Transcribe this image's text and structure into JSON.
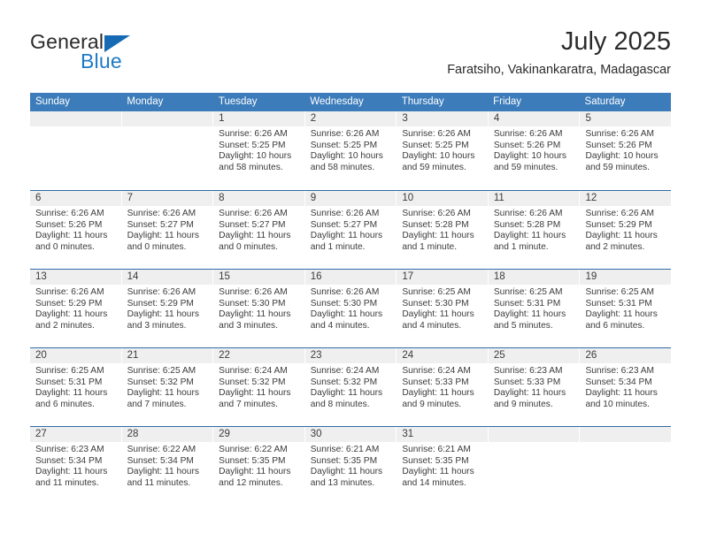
{
  "brand": {
    "name_part1": "General",
    "name_part2": "Blue",
    "triangle_color": "#166ab4",
    "blue_color": "#1f7ac4"
  },
  "header": {
    "title": "July 2025",
    "subtitle": "Faratsiho, Vakinankaratra, Madagascar"
  },
  "theme": {
    "header_row_bg": "#3c7cba",
    "row_divider": "#2f6ca8",
    "daynum_band": "#efefef",
    "text": "#3b3b3b"
  },
  "weekdays": [
    "Sunday",
    "Monday",
    "Tuesday",
    "Wednesday",
    "Thursday",
    "Friday",
    "Saturday"
  ],
  "weeks": [
    [
      {
        "day": ""
      },
      {
        "day": ""
      },
      {
        "day": "1",
        "sunrise": "Sunrise: 6:26 AM",
        "sunset": "Sunset: 5:25 PM",
        "daylight1": "Daylight: 10 hours",
        "daylight2": "and 58 minutes."
      },
      {
        "day": "2",
        "sunrise": "Sunrise: 6:26 AM",
        "sunset": "Sunset: 5:25 PM",
        "daylight1": "Daylight: 10 hours",
        "daylight2": "and 58 minutes."
      },
      {
        "day": "3",
        "sunrise": "Sunrise: 6:26 AM",
        "sunset": "Sunset: 5:25 PM",
        "daylight1": "Daylight: 10 hours",
        "daylight2": "and 59 minutes."
      },
      {
        "day": "4",
        "sunrise": "Sunrise: 6:26 AM",
        "sunset": "Sunset: 5:26 PM",
        "daylight1": "Daylight: 10 hours",
        "daylight2": "and 59 minutes."
      },
      {
        "day": "5",
        "sunrise": "Sunrise: 6:26 AM",
        "sunset": "Sunset: 5:26 PM",
        "daylight1": "Daylight: 10 hours",
        "daylight2": "and 59 minutes."
      }
    ],
    [
      {
        "day": "6",
        "sunrise": "Sunrise: 6:26 AM",
        "sunset": "Sunset: 5:26 PM",
        "daylight1": "Daylight: 11 hours",
        "daylight2": "and 0 minutes."
      },
      {
        "day": "7",
        "sunrise": "Sunrise: 6:26 AM",
        "sunset": "Sunset: 5:27 PM",
        "daylight1": "Daylight: 11 hours",
        "daylight2": "and 0 minutes."
      },
      {
        "day": "8",
        "sunrise": "Sunrise: 6:26 AM",
        "sunset": "Sunset: 5:27 PM",
        "daylight1": "Daylight: 11 hours",
        "daylight2": "and 0 minutes."
      },
      {
        "day": "9",
        "sunrise": "Sunrise: 6:26 AM",
        "sunset": "Sunset: 5:27 PM",
        "daylight1": "Daylight: 11 hours",
        "daylight2": "and 1 minute."
      },
      {
        "day": "10",
        "sunrise": "Sunrise: 6:26 AM",
        "sunset": "Sunset: 5:28 PM",
        "daylight1": "Daylight: 11 hours",
        "daylight2": "and 1 minute."
      },
      {
        "day": "11",
        "sunrise": "Sunrise: 6:26 AM",
        "sunset": "Sunset: 5:28 PM",
        "daylight1": "Daylight: 11 hours",
        "daylight2": "and 1 minute."
      },
      {
        "day": "12",
        "sunrise": "Sunrise: 6:26 AM",
        "sunset": "Sunset: 5:29 PM",
        "daylight1": "Daylight: 11 hours",
        "daylight2": "and 2 minutes."
      }
    ],
    [
      {
        "day": "13",
        "sunrise": "Sunrise: 6:26 AM",
        "sunset": "Sunset: 5:29 PM",
        "daylight1": "Daylight: 11 hours",
        "daylight2": "and 2 minutes."
      },
      {
        "day": "14",
        "sunrise": "Sunrise: 6:26 AM",
        "sunset": "Sunset: 5:29 PM",
        "daylight1": "Daylight: 11 hours",
        "daylight2": "and 3 minutes."
      },
      {
        "day": "15",
        "sunrise": "Sunrise: 6:26 AM",
        "sunset": "Sunset: 5:30 PM",
        "daylight1": "Daylight: 11 hours",
        "daylight2": "and 3 minutes."
      },
      {
        "day": "16",
        "sunrise": "Sunrise: 6:26 AM",
        "sunset": "Sunset: 5:30 PM",
        "daylight1": "Daylight: 11 hours",
        "daylight2": "and 4 minutes."
      },
      {
        "day": "17",
        "sunrise": "Sunrise: 6:25 AM",
        "sunset": "Sunset: 5:30 PM",
        "daylight1": "Daylight: 11 hours",
        "daylight2": "and 4 minutes."
      },
      {
        "day": "18",
        "sunrise": "Sunrise: 6:25 AM",
        "sunset": "Sunset: 5:31 PM",
        "daylight1": "Daylight: 11 hours",
        "daylight2": "and 5 minutes."
      },
      {
        "day": "19",
        "sunrise": "Sunrise: 6:25 AM",
        "sunset": "Sunset: 5:31 PM",
        "daylight1": "Daylight: 11 hours",
        "daylight2": "and 6 minutes."
      }
    ],
    [
      {
        "day": "20",
        "sunrise": "Sunrise: 6:25 AM",
        "sunset": "Sunset: 5:31 PM",
        "daylight1": "Daylight: 11 hours",
        "daylight2": "and 6 minutes."
      },
      {
        "day": "21",
        "sunrise": "Sunrise: 6:25 AM",
        "sunset": "Sunset: 5:32 PM",
        "daylight1": "Daylight: 11 hours",
        "daylight2": "and 7 minutes."
      },
      {
        "day": "22",
        "sunrise": "Sunrise: 6:24 AM",
        "sunset": "Sunset: 5:32 PM",
        "daylight1": "Daylight: 11 hours",
        "daylight2": "and 7 minutes."
      },
      {
        "day": "23",
        "sunrise": "Sunrise: 6:24 AM",
        "sunset": "Sunset: 5:32 PM",
        "daylight1": "Daylight: 11 hours",
        "daylight2": "and 8 minutes."
      },
      {
        "day": "24",
        "sunrise": "Sunrise: 6:24 AM",
        "sunset": "Sunset: 5:33 PM",
        "daylight1": "Daylight: 11 hours",
        "daylight2": "and 9 minutes."
      },
      {
        "day": "25",
        "sunrise": "Sunrise: 6:23 AM",
        "sunset": "Sunset: 5:33 PM",
        "daylight1": "Daylight: 11 hours",
        "daylight2": "and 9 minutes."
      },
      {
        "day": "26",
        "sunrise": "Sunrise: 6:23 AM",
        "sunset": "Sunset: 5:34 PM",
        "daylight1": "Daylight: 11 hours",
        "daylight2": "and 10 minutes."
      }
    ],
    [
      {
        "day": "27",
        "sunrise": "Sunrise: 6:23 AM",
        "sunset": "Sunset: 5:34 PM",
        "daylight1": "Daylight: 11 hours",
        "daylight2": "and 11 minutes."
      },
      {
        "day": "28",
        "sunrise": "Sunrise: 6:22 AM",
        "sunset": "Sunset: 5:34 PM",
        "daylight1": "Daylight: 11 hours",
        "daylight2": "and 11 minutes."
      },
      {
        "day": "29",
        "sunrise": "Sunrise: 6:22 AM",
        "sunset": "Sunset: 5:35 PM",
        "daylight1": "Daylight: 11 hours",
        "daylight2": "and 12 minutes."
      },
      {
        "day": "30",
        "sunrise": "Sunrise: 6:21 AM",
        "sunset": "Sunset: 5:35 PM",
        "daylight1": "Daylight: 11 hours",
        "daylight2": "and 13 minutes."
      },
      {
        "day": "31",
        "sunrise": "Sunrise: 6:21 AM",
        "sunset": "Sunset: 5:35 PM",
        "daylight1": "Daylight: 11 hours",
        "daylight2": "and 14 minutes."
      },
      {
        "day": ""
      },
      {
        "day": ""
      }
    ]
  ]
}
